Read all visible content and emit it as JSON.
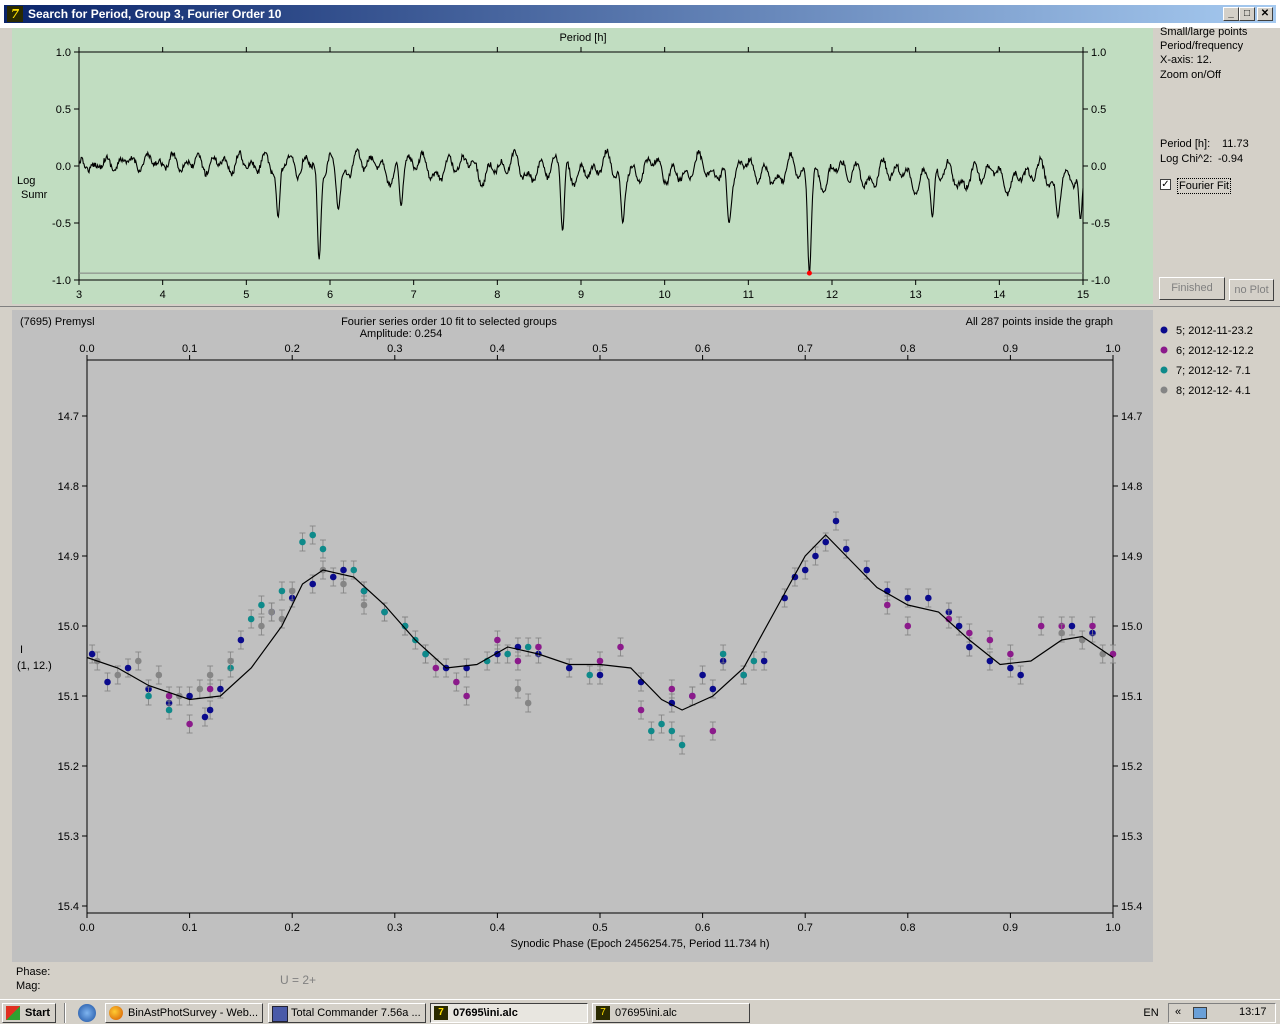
{
  "window": {
    "title": "Search for Period, Group 3, Fourier Order 10",
    "minimize": "_",
    "maximize": "□",
    "close": "✕"
  },
  "side_panel": {
    "menu": [
      "Small/large points",
      "Period/frequency",
      "X-axis: 12.",
      "Zoom on/Off"
    ],
    "period_label": "Period [h]:",
    "period_value": "11.73",
    "logchi_label": "Log Chi^2:",
    "logchi_value": "-0.94",
    "fourier_fit_label": "Fourier Fit",
    "fourier_fit_checked": true,
    "finished_button": "Finished",
    "noplot_button": "no Plot"
  },
  "status": {
    "phase_label": "Phase:",
    "mag_label": "Mag:",
    "u_label": "U = 2+"
  },
  "taskbar": {
    "start": "Start",
    "tasks": [
      {
        "label": "BinAstPhotSurvey - Web...",
        "active": false
      },
      {
        "label": "Total Commander 7.56a ...",
        "active": false
      },
      {
        "label": "07695\\ini.alc",
        "active": true
      },
      {
        "label": "07695\\ini.alc",
        "active": false
      }
    ],
    "lang": "EN",
    "clock": "13:17"
  },
  "chart_data": [
    {
      "type": "line",
      "title": "Period [h]",
      "xlabel": "Period [h]",
      "ylabel": "Log Sumr",
      "xlim": [
        3,
        15
      ],
      "ylim": [
        -1.0,
        1.0
      ],
      "xticks": [
        "3",
        "4",
        "5",
        "6",
        "7",
        "8",
        "9",
        "10",
        "11",
        "12",
        "13",
        "14",
        "15"
      ],
      "yticks": [
        "1.0",
        "0.5",
        "0.0",
        "-0.5",
        "-1.0"
      ],
      "background": "#c1ddc1",
      "series_color": "#000000",
      "minimum": {
        "x": 11.73,
        "y": -0.94,
        "color": "#ff0000"
      },
      "reference_line_y": -0.94,
      "dips": [
        {
          "x": 5.38,
          "y": -0.45
        },
        {
          "x": 5.87,
          "y": -0.82
        },
        {
          "x": 6.1,
          "y": -0.38
        },
        {
          "x": 6.85,
          "y": -0.35
        },
        {
          "x": 8.78,
          "y": -0.57
        },
        {
          "x": 9.5,
          "y": -0.5
        },
        {
          "x": 10.77,
          "y": -0.5
        },
        {
          "x": 11.73,
          "y": -0.94
        },
        {
          "x": 13.2,
          "y": -0.45
        },
        {
          "x": 14.7,
          "y": -0.45
        },
        {
          "x": 14.97,
          "y": -0.47
        }
      ]
    },
    {
      "type": "scatter",
      "object_label": "(7695) Premysl",
      "title": "Fourier series order 10 fit to selected groups",
      "subtitle": "Amplitude: 0.254",
      "note": "All 287 points inside the graph",
      "xlabel": "Synodic Phase (Epoch 2456254.75, Period 11.734 h)",
      "ylabel": "I",
      "ylabel2": "(1, 12.)",
      "xlim": [
        0.0,
        1.0
      ],
      "ylim": [
        14.62,
        15.41
      ],
      "y_inverted": true,
      "xticks": [
        "0.0",
        "0.1",
        "0.2",
        "0.3",
        "0.4",
        "0.5",
        "0.6",
        "0.7",
        "0.8",
        "0.9",
        "1.0"
      ],
      "yticks": [
        "14.7",
        "14.8",
        "14.9",
        "15.0",
        "15.1",
        "15.2",
        "15.3",
        "15.4"
      ],
      "background": "#c0c0c0",
      "fit_curve": {
        "color": "#000000",
        "points": [
          [
            0.0,
            15.045
          ],
          [
            0.03,
            15.06
          ],
          [
            0.06,
            15.085
          ],
          [
            0.1,
            15.105
          ],
          [
            0.13,
            15.1
          ],
          [
            0.16,
            15.06
          ],
          [
            0.19,
            15.0
          ],
          [
            0.21,
            14.94
          ],
          [
            0.23,
            14.92
          ],
          [
            0.26,
            14.93
          ],
          [
            0.29,
            14.97
          ],
          [
            0.32,
            15.02
          ],
          [
            0.35,
            15.06
          ],
          [
            0.38,
            15.055
          ],
          [
            0.41,
            15.03
          ],
          [
            0.44,
            15.04
          ],
          [
            0.47,
            15.055
          ],
          [
            0.5,
            15.055
          ],
          [
            0.53,
            15.06
          ],
          [
            0.56,
            15.105
          ],
          [
            0.58,
            15.12
          ],
          [
            0.61,
            15.1
          ],
          [
            0.64,
            15.06
          ],
          [
            0.67,
            14.98
          ],
          [
            0.7,
            14.9
          ],
          [
            0.72,
            14.87
          ],
          [
            0.74,
            14.9
          ],
          [
            0.77,
            14.945
          ],
          [
            0.8,
            14.97
          ],
          [
            0.83,
            14.98
          ],
          [
            0.86,
            15.02
          ],
          [
            0.89,
            15.055
          ],
          [
            0.92,
            15.05
          ],
          [
            0.95,
            15.02
          ],
          [
            0.97,
            15.015
          ],
          [
            1.0,
            15.045
          ]
        ]
      },
      "series": [
        {
          "name": "5; 2012-11-23.2",
          "color": "#0a0a8c",
          "points": [
            [
              0.005,
              15.04
            ],
            [
              0.02,
              15.08
            ],
            [
              0.04,
              15.06
            ],
            [
              0.06,
              15.09
            ],
            [
              0.08,
              15.11
            ],
            [
              0.1,
              15.1
            ],
            [
              0.115,
              15.13
            ],
            [
              0.12,
              15.12
            ],
            [
              0.13,
              15.09
            ],
            [
              0.15,
              15.02
            ],
            [
              0.18,
              14.98
            ],
            [
              0.2,
              14.96
            ],
            [
              0.22,
              14.94
            ],
            [
              0.24,
              14.93
            ],
            [
              0.25,
              14.92
            ],
            [
              0.27,
              14.95
            ],
            [
              0.29,
              14.98
            ],
            [
              0.31,
              15.0
            ],
            [
              0.33,
              15.04
            ],
            [
              0.35,
              15.06
            ],
            [
              0.37,
              15.06
            ],
            [
              0.4,
              15.04
            ],
            [
              0.42,
              15.03
            ],
            [
              0.44,
              15.04
            ],
            [
              0.47,
              15.06
            ],
            [
              0.5,
              15.07
            ],
            [
              0.54,
              15.08
            ],
            [
              0.57,
              15.11
            ],
            [
              0.59,
              15.1
            ],
            [
              0.6,
              15.07
            ],
            [
              0.61,
              15.09
            ],
            [
              0.62,
              15.05
            ],
            [
              0.64,
              15.07
            ],
            [
              0.66,
              15.05
            ],
            [
              0.68,
              14.96
            ],
            [
              0.69,
              14.93
            ],
            [
              0.7,
              14.92
            ],
            [
              0.71,
              14.9
            ],
            [
              0.72,
              14.88
            ],
            [
              0.73,
              14.85
            ],
            [
              0.74,
              14.89
            ],
            [
              0.76,
              14.92
            ],
            [
              0.78,
              14.95
            ],
            [
              0.8,
              14.96
            ],
            [
              0.82,
              14.96
            ],
            [
              0.84,
              14.98
            ],
            [
              0.85,
              15.0
            ],
            [
              0.86,
              15.03
            ],
            [
              0.88,
              15.05
            ],
            [
              0.9,
              15.06
            ],
            [
              0.91,
              15.07
            ],
            [
              0.96,
              15.0
            ],
            [
              0.98,
              15.01
            ]
          ]
        },
        {
          "name": "6; 2012-12-12.2",
          "color": "#8b1a8b",
          "points": [
            [
              0.08,
              15.1
            ],
            [
              0.1,
              15.14
            ],
            [
              0.12,
              15.09
            ],
            [
              0.34,
              15.06
            ],
            [
              0.36,
              15.08
            ],
            [
              0.37,
              15.1
            ],
            [
              0.4,
              15.02
            ],
            [
              0.42,
              15.05
            ],
            [
              0.44,
              15.03
            ],
            [
              0.5,
              15.05
            ],
            [
              0.52,
              15.03
            ],
            [
              0.54,
              15.12
            ],
            [
              0.57,
              15.09
            ],
            [
              0.59,
              15.1
            ],
            [
              0.61,
              15.15
            ],
            [
              0.78,
              14.97
            ],
            [
              0.8,
              15.0
            ],
            [
              0.84,
              14.99
            ],
            [
              0.86,
              15.01
            ],
            [
              0.88,
              15.02
            ],
            [
              0.9,
              15.04
            ],
            [
              0.93,
              15.0
            ],
            [
              0.95,
              15.0
            ],
            [
              0.98,
              15.0
            ],
            [
              1.0,
              15.04
            ]
          ]
        },
        {
          "name": "7; 2012-12- 7.1",
          "color": "#0e8a8a",
          "points": [
            [
              0.06,
              15.1
            ],
            [
              0.08,
              15.12
            ],
            [
              0.14,
              15.06
            ],
            [
              0.16,
              14.99
            ],
            [
              0.17,
              14.97
            ],
            [
              0.19,
              14.95
            ],
            [
              0.21,
              14.88
            ],
            [
              0.22,
              14.87
            ],
            [
              0.23,
              14.89
            ],
            [
              0.26,
              14.92
            ],
            [
              0.27,
              14.95
            ],
            [
              0.29,
              14.98
            ],
            [
              0.31,
              15.0
            ],
            [
              0.32,
              15.02
            ],
            [
              0.33,
              15.04
            ],
            [
              0.39,
              15.05
            ],
            [
              0.41,
              15.04
            ],
            [
              0.43,
              15.03
            ],
            [
              0.49,
              15.07
            ],
            [
              0.55,
              15.15
            ],
            [
              0.56,
              15.14
            ],
            [
              0.57,
              15.15
            ],
            [
              0.58,
              15.17
            ],
            [
              0.64,
              15.07
            ],
            [
              0.65,
              15.05
            ],
            [
              0.62,
              15.04
            ]
          ]
        },
        {
          "name": "8; 2012-12- 4.1",
          "color": "#858585",
          "points": [
            [
              0.01,
              15.05
            ],
            [
              0.03,
              15.07
            ],
            [
              0.05,
              15.05
            ],
            [
              0.07,
              15.07
            ],
            [
              0.09,
              15.1
            ],
            [
              0.11,
              15.09
            ],
            [
              0.12,
              15.07
            ],
            [
              0.14,
              15.05
            ],
            [
              0.17,
              15.0
            ],
            [
              0.18,
              14.98
            ],
            [
              0.19,
              14.99
            ],
            [
              0.2,
              14.95
            ],
            [
              0.23,
              14.92
            ],
            [
              0.25,
              14.94
            ],
            [
              0.27,
              14.97
            ],
            [
              0.42,
              15.09
            ],
            [
              0.43,
              15.11
            ],
            [
              0.95,
              15.01
            ],
            [
              0.97,
              15.02
            ],
            [
              0.99,
              15.04
            ]
          ]
        }
      ]
    }
  ]
}
